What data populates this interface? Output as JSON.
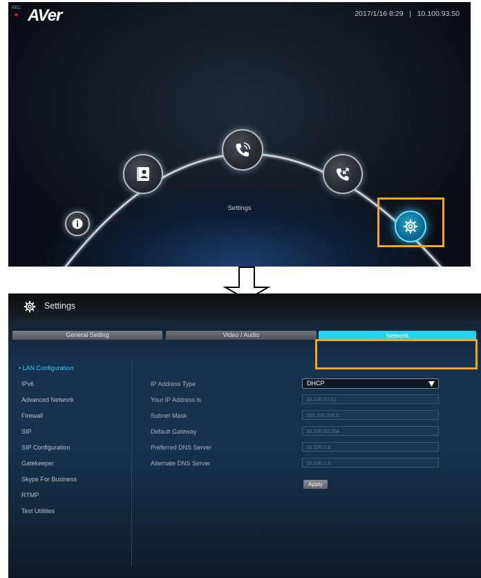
{
  "home": {
    "recording_indicator": "REC",
    "logo": "AVer",
    "datetime": "2017/1/16 8:29",
    "separator": "|",
    "ip": "10.100.93.50",
    "selected_label": "Settings",
    "orbs": [
      "info-icon",
      "contacts-icon",
      "call-icon",
      "call-history-icon",
      "settings-gear-icon"
    ]
  },
  "settings": {
    "title": "Settings",
    "tabs": [
      {
        "label": "General Setting"
      },
      {
        "label": "Video / Audio"
      },
      {
        "label": "Network"
      }
    ],
    "active_tab": "Network",
    "sidebar": [
      {
        "label": "• LAN Configuration"
      },
      {
        "label": "IPv6"
      },
      {
        "label": "Advanced Network"
      },
      {
        "label": "Firewall"
      },
      {
        "label": "SIP"
      },
      {
        "label": "SIP Configuration"
      },
      {
        "label": "Gatekeeper"
      },
      {
        "label": "Skype For Business"
      },
      {
        "label": "RTMP"
      },
      {
        "label": "Test Utilities"
      }
    ],
    "form": {
      "ip_type_label": "IP Address Type",
      "ip_type_value": "DHCP",
      "fields": [
        {
          "label": "Your IP Address is",
          "value": "10.100.93.51"
        },
        {
          "label": "Subnet Mask",
          "value": "255.255.255.0"
        },
        {
          "label": "Default Gateway",
          "value": "10.100.93.254"
        },
        {
          "label": "Preferred DNS Server",
          "value": "10.100.1.8"
        },
        {
          "label": "Alternate DNS Server",
          "value": "10.100.1.6"
        }
      ],
      "apply_label": "Apply"
    }
  },
  "colors": {
    "highlight": "#f5a623",
    "accent": "#22d4f0"
  }
}
